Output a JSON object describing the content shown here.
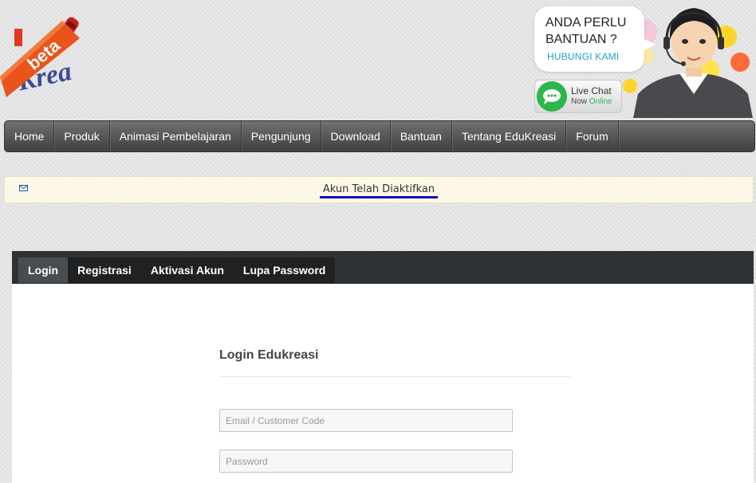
{
  "header": {
    "logo_badge": "beta",
    "logo_word": "Krea",
    "help_question": "ANDA PERLU BANTUAN ?",
    "help_contact": "HUBUNGI KAMI",
    "livechat_title": "Live Chat",
    "livechat_status_prefix": "Now",
    "livechat_status": "Online"
  },
  "nav": {
    "items": [
      "Home",
      "Produk",
      "Animasi Pembelajaran",
      "Pengunjung",
      "Download",
      "Bantuan",
      "Tentang EduKreasi",
      "Forum"
    ]
  },
  "alert": {
    "message": "Akun Telah Diaktifkan",
    "icon": "envelope-icon"
  },
  "tabs": {
    "items": [
      "Login",
      "Registrasi",
      "Aktivasi Akun",
      "Lupa Password"
    ],
    "active": "Login"
  },
  "login": {
    "title": "Login Edukreasi",
    "email_placeholder": "Email / Customer Code",
    "password_placeholder": "Password"
  },
  "colors": {
    "nav_gradient_top": "#707070",
    "nav_gradient_bottom": "#404040",
    "alert_bg": "#fdf8e6",
    "link_underline": "#1010c0",
    "help_accent": "#1aa3c8",
    "livechat_green": "#2db64a",
    "tabbar_bg": "#2f3234"
  }
}
